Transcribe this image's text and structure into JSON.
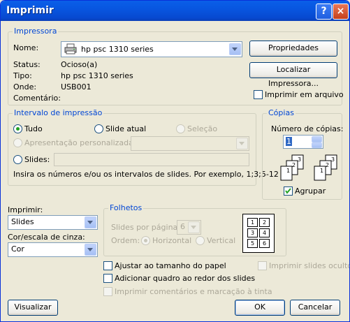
{
  "window": {
    "title": "Imprimir",
    "help": "?",
    "close": "×"
  },
  "printer": {
    "group_label": "Impressora",
    "name_label": "Nome:",
    "name_value": "hp psc 1310 series",
    "status_label": "Status:",
    "status_value": "Ocioso(a)",
    "type_label": "Tipo:",
    "type_value": "hp psc 1310 series",
    "where_label": "Onde:",
    "where_value": "USB001",
    "comment_label": "Comentário:",
    "properties_button": "Propriedades",
    "find_button": "Localizar Impressora...",
    "print_to_file": "Imprimir em arquivo"
  },
  "range": {
    "group_label": "Intervalo de impressão",
    "all": "Tudo",
    "current_slide": "Slide atual",
    "selection": "Seleção",
    "custom_show": "Apresentação personalizada:",
    "slides": "Slides:",
    "hint": "Insira os números e/ou os intervalos de slides. Por exemplo, 1;3;5-12"
  },
  "copies": {
    "group_label": "Cópias",
    "count_label": "Número de cópias:",
    "count_value": "1",
    "collate": "Agrupar"
  },
  "print_what": {
    "label": "Imprimir:",
    "value": "Slides"
  },
  "color": {
    "label": "Cor/escala de cinza:",
    "value": "Cor"
  },
  "handouts": {
    "group_label": "Folhetos",
    "per_page_label": "Slides por página:",
    "per_page_value": "6",
    "order_label": "Ordem:",
    "horizontal": "Horizontal",
    "vertical": "Vertical",
    "preview_numbers": [
      "1",
      "2",
      "3",
      "4",
      "5",
      "6"
    ]
  },
  "options": {
    "fit": "Ajustar ao tamanho do papel",
    "frame": "Adicionar quadro ao redor dos slides",
    "comments": "Imprimir comentários e marcação à tinta",
    "hidden": "Imprimir slides ocultos"
  },
  "buttons": {
    "preview": "Visualizar",
    "ok": "OK",
    "cancel": "Cancelar"
  },
  "copy_pages": [
    "1",
    "2",
    "3"
  ]
}
